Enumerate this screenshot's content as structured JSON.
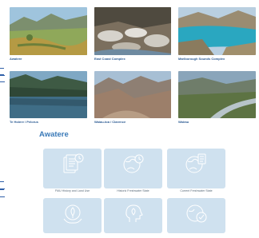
{
  "cards": [
    {
      "title": "Awatere"
    },
    {
      "title": "East Coast Complex"
    },
    {
      "title": "Marlborough Sounds Complex"
    },
    {
      "title": "Te Hoiere / Pelorus"
    },
    {
      "title": "Waiau-toa / Clarence"
    },
    {
      "title": "Wairau"
    }
  ],
  "section": {
    "title": "Awatere"
  },
  "tiles": [
    {
      "label": "FMU History and Land Use",
      "icon": "documents-clock-icon"
    },
    {
      "label": "Historic Freshwater State",
      "icon": "globe-clock-icon"
    },
    {
      "label": "Current Freshwater State",
      "icon": "globe-checklist-icon"
    },
    {
      "label": "",
      "icon": "hands-leaf-icon"
    },
    {
      "label": "",
      "icon": "head-leaf-icon"
    },
    {
      "label": "",
      "icon": "globe-check-icon"
    }
  ],
  "colors": {
    "caption": "#2b5a92",
    "section_title": "#3a7ab8",
    "tile_bg": "#cfe1ef",
    "icon_stroke": "#ffffff",
    "edge_link": "#2f5fa8"
  }
}
